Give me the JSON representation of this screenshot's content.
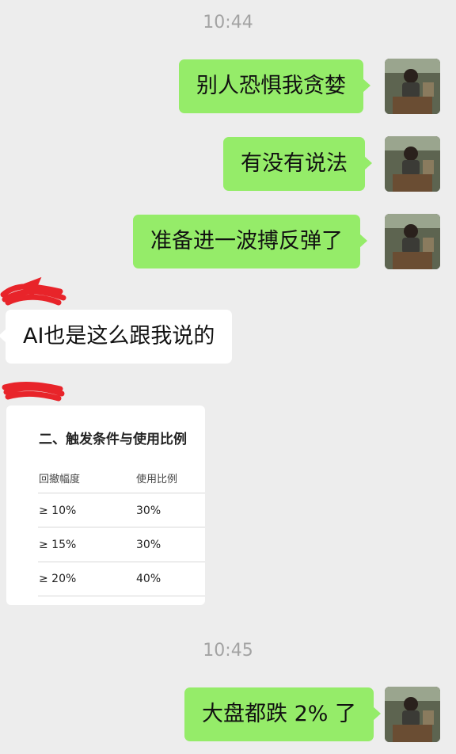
{
  "timestamps": [
    "10:44",
    "10:45"
  ],
  "messages": [
    {
      "side": "out",
      "text": "别人恐惧我贪婪"
    },
    {
      "side": "out",
      "text": "有没有说法"
    },
    {
      "side": "out",
      "text": "准备进一波搏反弹了"
    },
    {
      "side": "in",
      "text": "AI也是这么跟我说的"
    },
    {
      "side": "out",
      "text": "大盘都跌 2% 了"
    }
  ],
  "card": {
    "title": "二、触发条件与使用比例",
    "headers": [
      "回撤幅度",
      "使用比例"
    ],
    "rows": [
      [
        "≥ 10%",
        "30%"
      ],
      [
        "≥ 15%",
        "30%"
      ],
      [
        "≥ 20%",
        "40%"
      ]
    ]
  },
  "colors": {
    "background": "#ededed",
    "outgoing_bubble": "#95ec69",
    "incoming_bubble": "#ffffff",
    "redaction": "#e8242a"
  },
  "icons": {
    "avatar": "user-avatar-photo",
    "redaction": "red-scribble"
  }
}
